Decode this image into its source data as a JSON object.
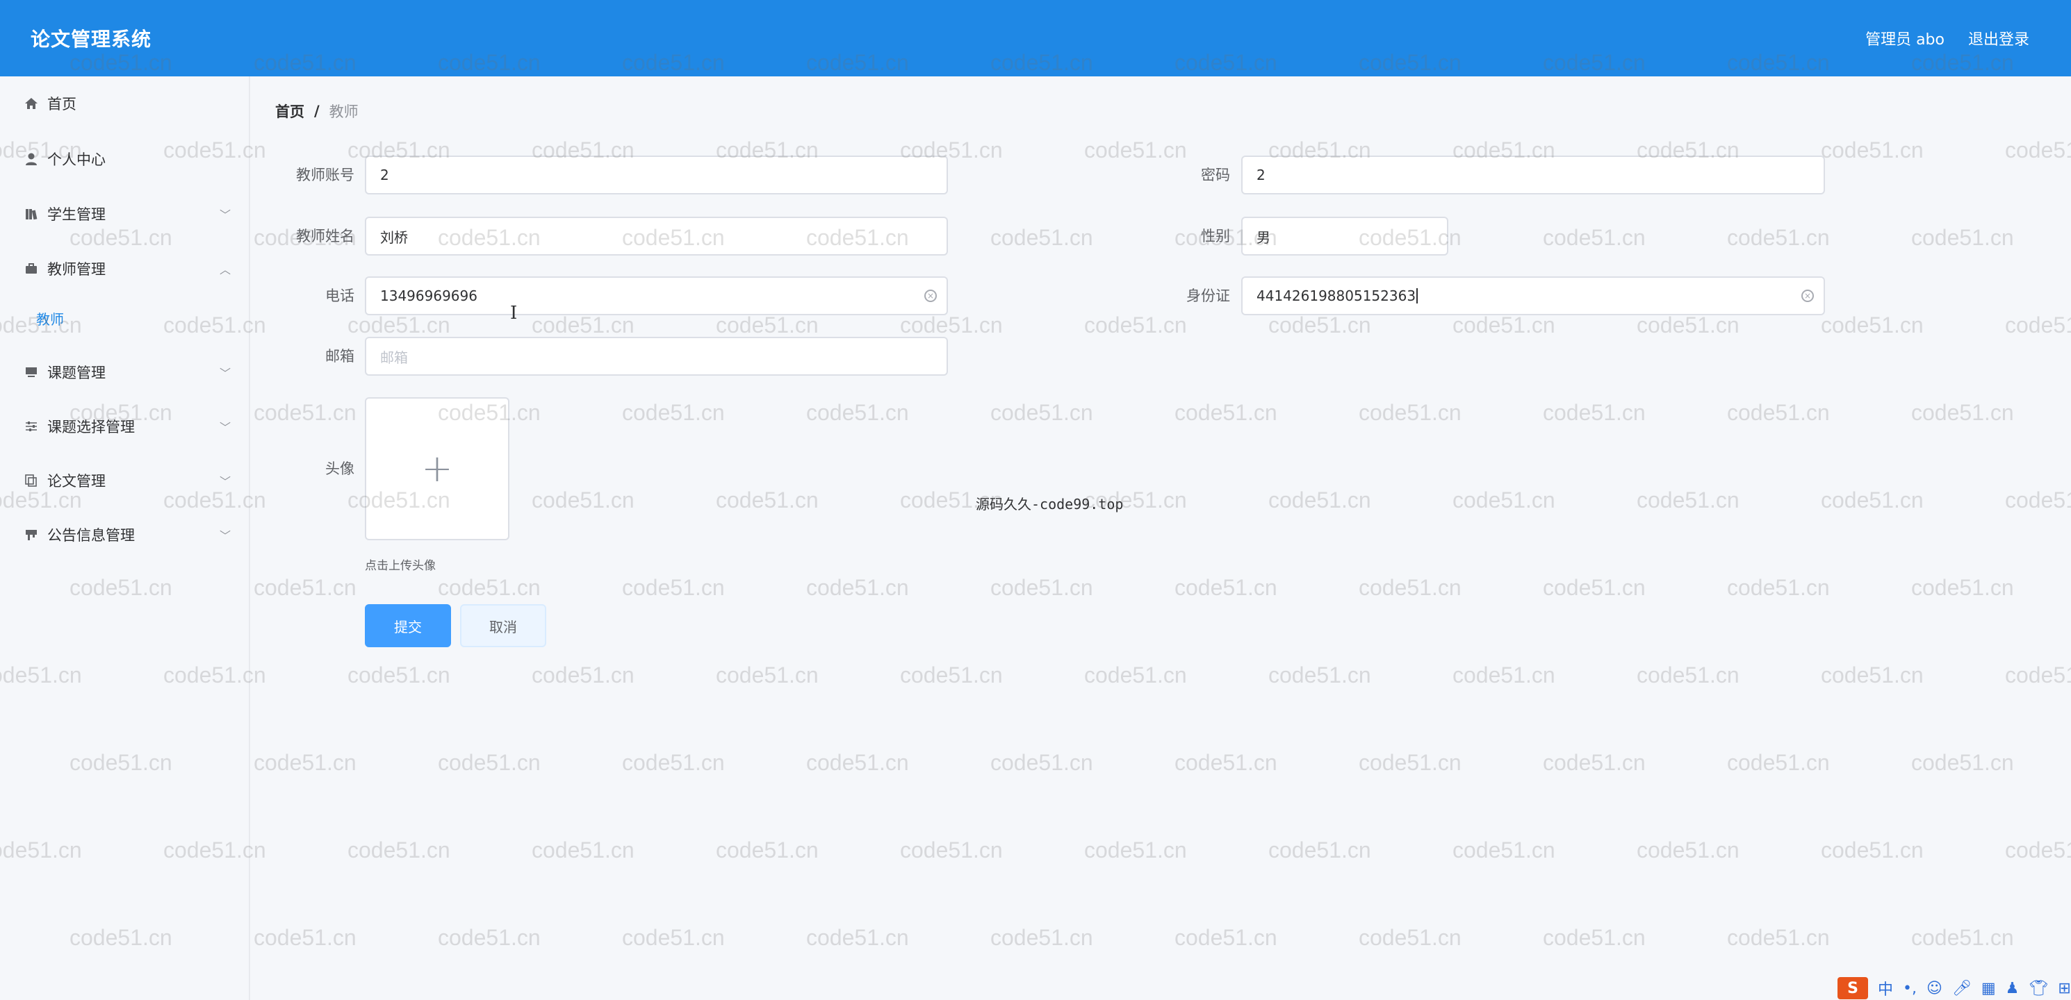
{
  "header": {
    "app_title": "论文管理系统",
    "user_label": "管理员 abo",
    "logout_label": "退出登录"
  },
  "sidebar": {
    "items": [
      {
        "label": "首页",
        "icon": "home-icon"
      },
      {
        "label": "个人中心",
        "icon": "user-icon"
      },
      {
        "label": "学生管理",
        "icon": "books-icon"
      },
      {
        "label": "教师管理",
        "icon": "briefcase-icon"
      },
      {
        "label": "课题管理",
        "icon": "monitor-icon"
      },
      {
        "label": "课题选择管理",
        "icon": "sliders-icon"
      },
      {
        "label": "论文管理",
        "icon": "copy-icon"
      },
      {
        "label": "公告信息管理",
        "icon": "megaphone-icon"
      }
    ],
    "submenu": {
      "label": "教师"
    }
  },
  "breadcrumb": {
    "home": "首页",
    "separator": "/",
    "current": "教师"
  },
  "form": {
    "account": {
      "label": "教师账号",
      "value": "2"
    },
    "password": {
      "label": "密码",
      "value": "2"
    },
    "name": {
      "label": "教师姓名",
      "value": "刘桥"
    },
    "gender": {
      "label": "性别",
      "value": "男"
    },
    "phone": {
      "label": "电话",
      "value": "13496969696"
    },
    "id_card": {
      "label": "身份证",
      "value": "441426198805152363"
    },
    "email": {
      "label": "邮箱",
      "placeholder": "邮箱"
    },
    "avatar": {
      "label": "头像",
      "upload_hint": "点击上传头像"
    },
    "submit_label": "提交",
    "cancel_label": "取消"
  },
  "overlay_text": "源码久久-code99.top",
  "watermark_text": "code51.cn",
  "tray": {
    "logo": "S",
    "ime_label": "中"
  }
}
